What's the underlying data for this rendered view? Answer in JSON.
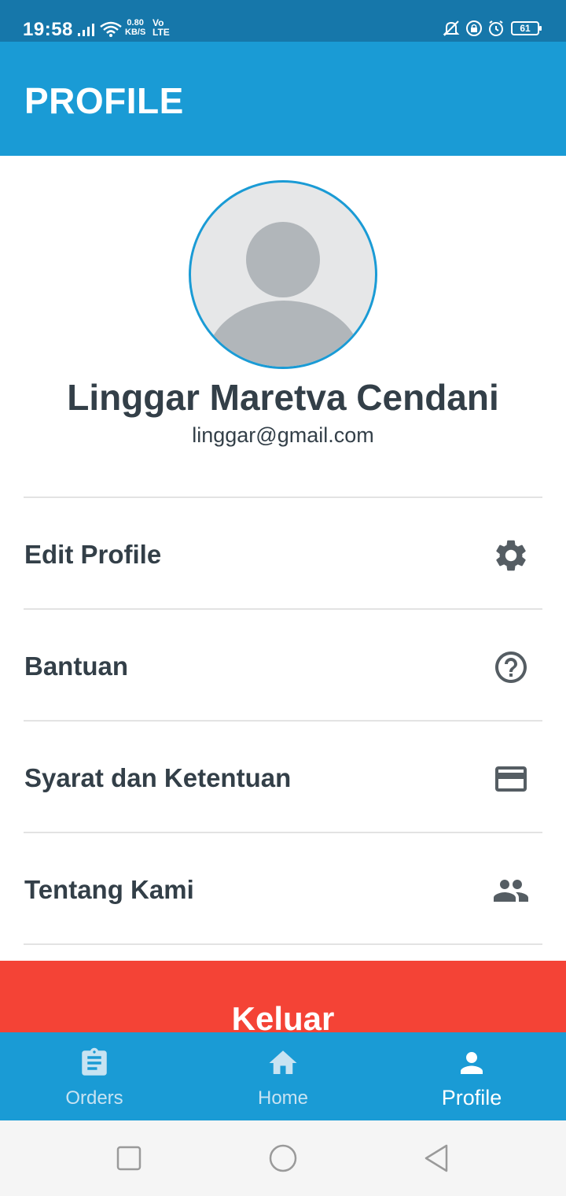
{
  "status_bar": {
    "time": "19:58",
    "speed_value": "0.80",
    "speed_unit": "KB/S",
    "volte_top": "Vo",
    "volte_bottom": "LTE",
    "battery": "61"
  },
  "appbar": {
    "title": "PROFILE"
  },
  "user": {
    "name": "Linggar Maretva Cendani",
    "email": "linggar@gmail.com"
  },
  "menu": [
    {
      "label": "Edit Profile",
      "icon": "gear-icon"
    },
    {
      "label": "Bantuan",
      "icon": "help-circle-icon"
    },
    {
      "label": "Syarat dan Ketentuan",
      "icon": "credit-card-icon"
    },
    {
      "label": "Tentang Kami",
      "icon": "people-icon"
    }
  ],
  "logout": {
    "label": "Keluar"
  },
  "bottom_nav": {
    "items": [
      {
        "label": "Orders",
        "icon": "clipboard-icon",
        "active": false
      },
      {
        "label": "Home",
        "icon": "home-icon",
        "active": false
      },
      {
        "label": "Profile",
        "icon": "person-icon",
        "active": true
      }
    ]
  },
  "colors": {
    "primary": "#1a9bd5",
    "status_bar": "#1677aa",
    "logout": "#f44336",
    "text_dark": "#333f48",
    "icon_gray": "#555d63"
  }
}
